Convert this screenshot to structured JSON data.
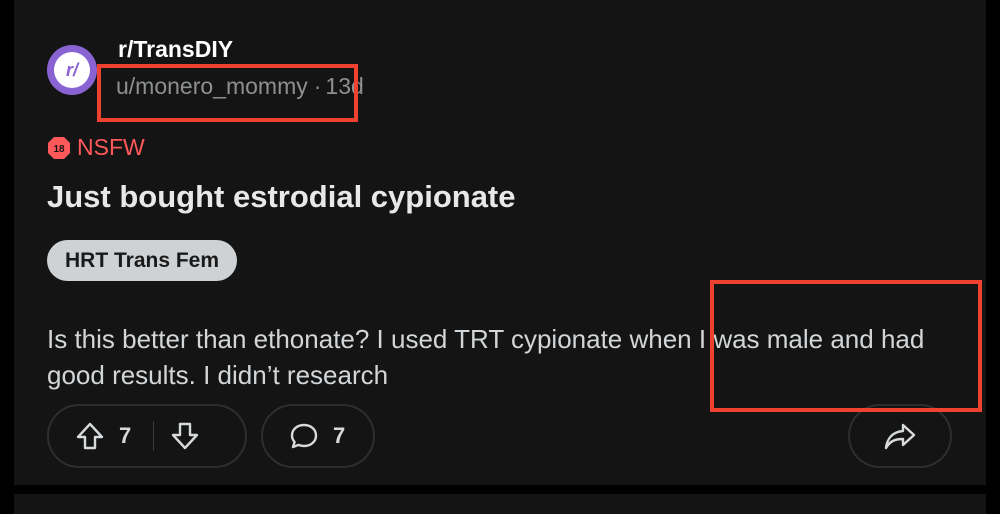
{
  "post": {
    "subreddit": "r/TransDIY",
    "avatar_letter": "r/",
    "author": "u/monero_mommy",
    "separator": "·",
    "age": "13d",
    "nsfw_label": "NSFW",
    "nsfw_badge_text": "18",
    "title": "Just bought estrodial cypionate",
    "flair": "HRT Trans Fem",
    "body": "Is this better than ethonate? I used TRT cypionate when I was male and had good results. I didn’t research",
    "upvotes": "7",
    "comments": "7"
  },
  "colors": {
    "background": "#000000",
    "card": "#141414",
    "avatar": "#8a63d2",
    "nsfw": "#ff585b",
    "flair_bg": "#cfd2d4",
    "highlight_box": "#ef4130"
  },
  "icons": {
    "upvote": "arrow-up-icon",
    "downvote": "arrow-down-icon",
    "comment": "comment-bubble-icon",
    "share": "share-arrow-icon",
    "nsfw": "nsfw-18-badge-icon"
  }
}
